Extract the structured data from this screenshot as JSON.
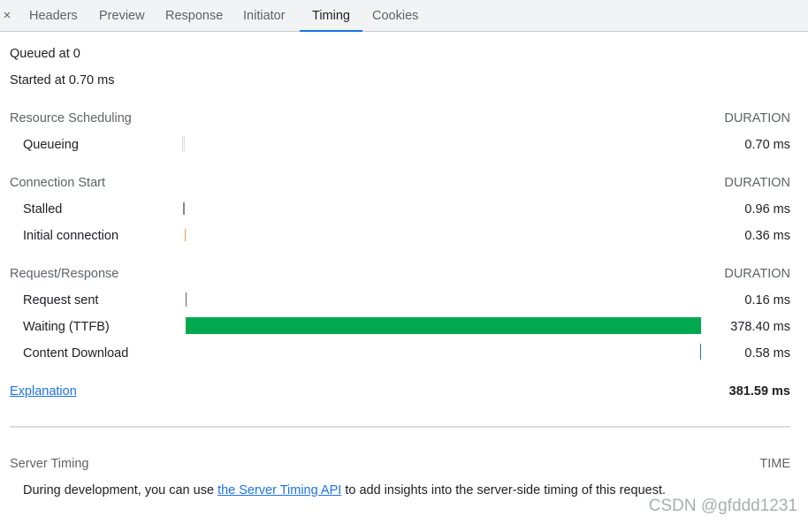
{
  "tabs": {
    "close_glyph": "×",
    "items": [
      {
        "label": "Headers",
        "active": false
      },
      {
        "label": "Preview",
        "active": false
      },
      {
        "label": "Response",
        "active": false
      },
      {
        "label": "Initiator",
        "active": false
      },
      {
        "label": "Timing",
        "active": true
      },
      {
        "label": "Cookies",
        "active": false
      }
    ]
  },
  "summary": {
    "queued": "Queued at 0",
    "started": "Started at 0.70 ms"
  },
  "sections": {
    "resource_scheduling": {
      "title": "Resource Scheduling",
      "duration_header": "DURATION",
      "rows": [
        {
          "label": "Queueing",
          "value": "0.70 ms"
        }
      ]
    },
    "connection_start": {
      "title": "Connection Start",
      "duration_header": "DURATION",
      "rows": [
        {
          "label": "Stalled",
          "value": "0.96 ms"
        },
        {
          "label": "Initial connection",
          "value": "0.36 ms"
        }
      ]
    },
    "request_response": {
      "title": "Request/Response",
      "duration_header": "DURATION",
      "rows": [
        {
          "label": "Request sent",
          "value": "0.16 ms"
        },
        {
          "label": "Waiting (TTFB)",
          "value": "378.40 ms"
        },
        {
          "label": "Content Download",
          "value": "0.58 ms"
        }
      ]
    }
  },
  "footer": {
    "explanation_link": "Explanation",
    "total": "381.59 ms"
  },
  "server_timing": {
    "title": "Server Timing",
    "time_header": "TIME",
    "text_before": "During development, you can use ",
    "link": "the Server Timing API",
    "text_after": " to add insights into the server-side timing of this request."
  },
  "watermark": "CSDN @gfddd1231",
  "colors": {
    "queueing": "#dadce0",
    "stalled": "#80868b",
    "initial_connection": "#e5a24a",
    "request_sent": "#5f6368",
    "waiting": "#00a94f",
    "content_download": "#1a73e8",
    "active_tab_indicator": "#1a73e8",
    "link": "#1a73e8"
  }
}
